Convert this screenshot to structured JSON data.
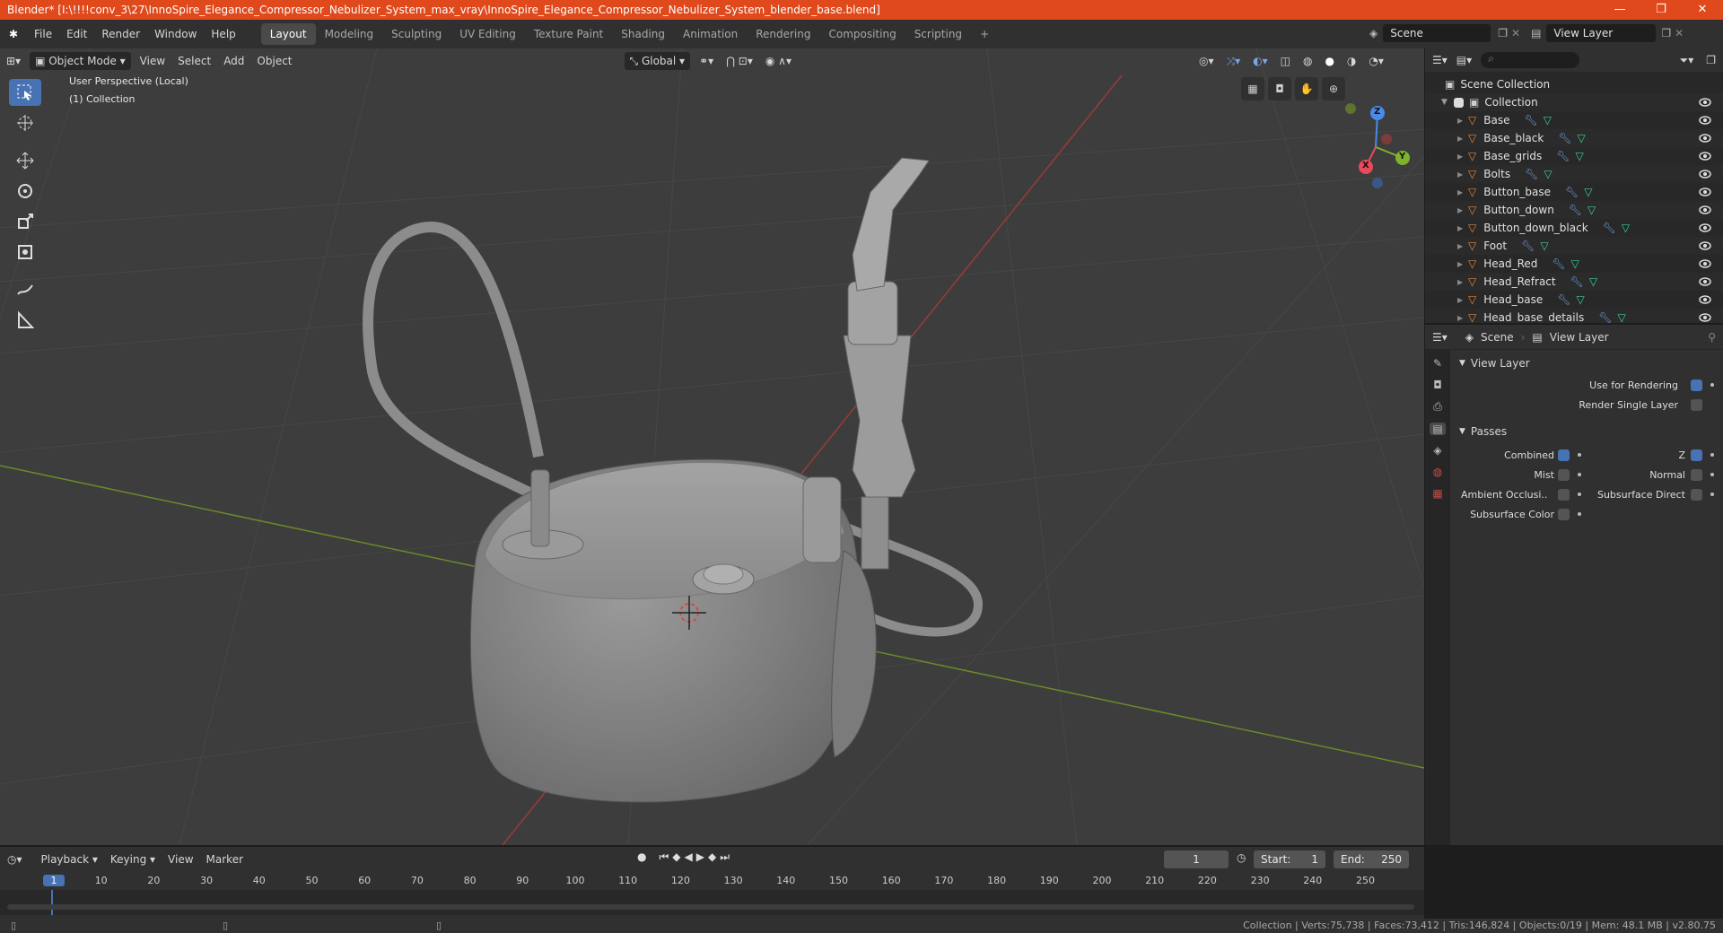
{
  "window": {
    "title": "Blender* [I:\\!!!!conv_3\\27\\InnoSpire_Elegance_Compressor_Nebulizer_System_max_vray\\InnoSpire_Elegance_Compressor_Nebulizer_System_blender_base.blend]",
    "controls": [
      "—",
      "❐",
      "✕"
    ]
  },
  "menu": [
    "File",
    "Edit",
    "Render",
    "Window",
    "Help"
  ],
  "workspaces": [
    "Layout",
    "Modeling",
    "Sculpting",
    "UV Editing",
    "Texture Paint",
    "Shading",
    "Animation",
    "Rendering",
    "Compositing",
    "Scripting"
  ],
  "active_workspace": "Layout",
  "scene_selector": {
    "value": "Scene"
  },
  "view_layer_selector": {
    "value": "View Layer"
  },
  "viewport_header": {
    "mode": "Object Mode",
    "menus": [
      "View",
      "Select",
      "Add",
      "Object"
    ],
    "orientation": "Global"
  },
  "viewport": {
    "info_line1": "User Perspective (Local)",
    "info_line2": "(1) Collection",
    "gizmo": {
      "x": "X",
      "y": "Y",
      "z": "Z"
    }
  },
  "outliner": {
    "root": "Scene Collection",
    "collection": "Collection",
    "items": [
      "Base",
      "Base_black",
      "Base_grids",
      "Bolts",
      "Button_base",
      "Button_down",
      "Button_down_black",
      "Foot",
      "Head_Red",
      "Head_Refract",
      "Head_base",
      "Head_base_details"
    ]
  },
  "properties": {
    "tabs": {
      "scene": "Scene",
      "view_layer": "View Layer"
    },
    "view_layer_panel": {
      "title": "View Layer",
      "use_for_rendering": "Use for Rendering",
      "render_single_layer": "Render Single Layer"
    },
    "passes": {
      "title": "Passes",
      "combined": "Combined",
      "z": "Z",
      "mist": "Mist",
      "normal": "Normal",
      "ambient_occlusion": "Ambient Occlusi..",
      "subsurface_direct": "Subsurface Direct",
      "subsurface_color": "Subsurface Color"
    }
  },
  "timeline": {
    "menus": [
      "Playback",
      "Keying",
      "View",
      "Marker"
    ],
    "current_frame": "1",
    "start_label": "Start:",
    "start_value": "1",
    "end_label": "End:",
    "end_value": "250",
    "ruler": [
      "1",
      "10",
      "20",
      "30",
      "40",
      "50",
      "60",
      "70",
      "80",
      "90",
      "100",
      "110",
      "120",
      "130",
      "140",
      "150",
      "160",
      "170",
      "180",
      "190",
      "200",
      "210",
      "220",
      "230",
      "240",
      "250"
    ]
  },
  "status": {
    "text": "Collection | Verts:75,738 | Faces:73,412 | Tris:146,824 | Objects:0/19 | Mem: 48.1 MB | v2.80.75"
  },
  "colors": {
    "accent": "#4772b3",
    "titlebar": "#e0491b",
    "mesh_icon": "#e5863b",
    "modifier_icon": "#6d9bd8",
    "data_icon": "#3ecf9a"
  }
}
